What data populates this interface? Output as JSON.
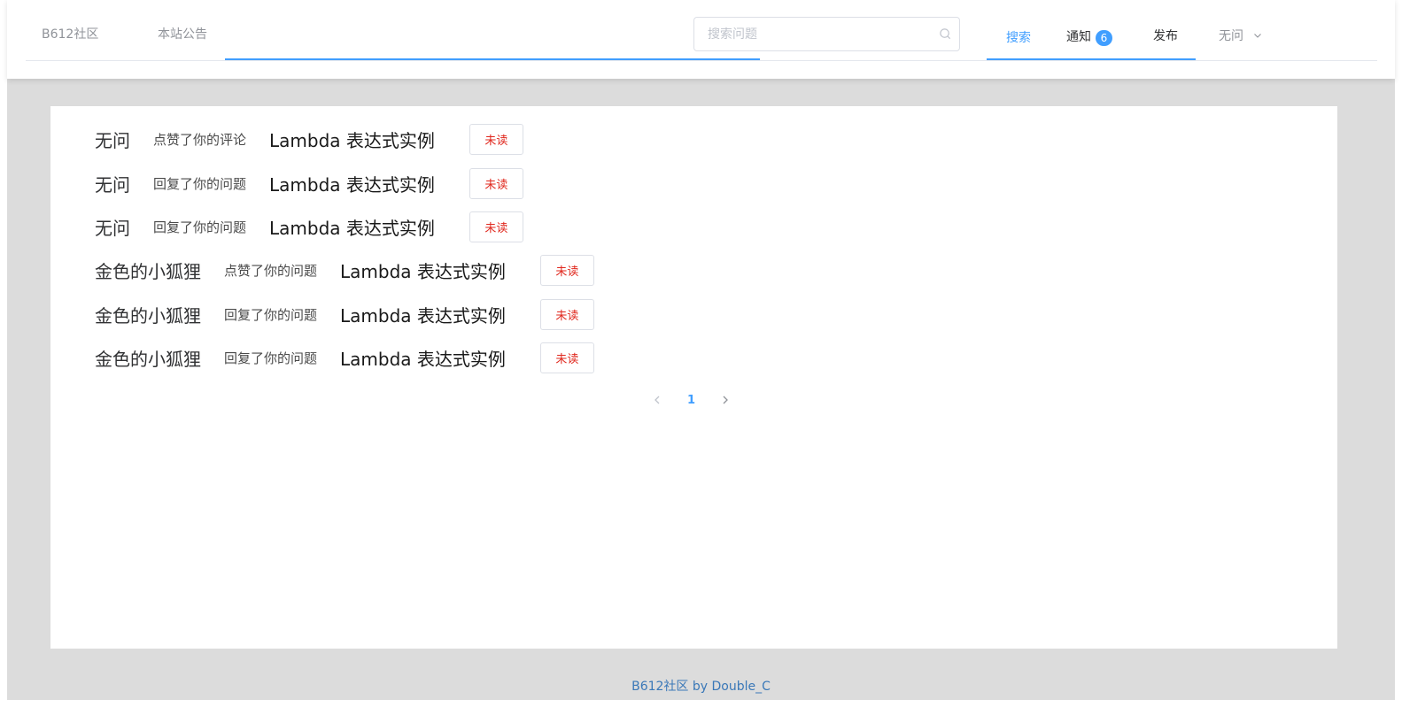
{
  "header": {
    "brand": "B612社区",
    "notice": "本站公告",
    "search": {
      "placeholder": "搜索问题",
      "value": ""
    },
    "menu": {
      "search": "搜索",
      "notify": "通知",
      "notify_count": "6",
      "publish": "发布",
      "user": "无问"
    }
  },
  "notifications": [
    {
      "user": "无问",
      "action": "点赞了你的评论",
      "question": "Lambda 表达式实例",
      "status": "未读"
    },
    {
      "user": "无问",
      "action": "回复了你的问题",
      "question": "Lambda 表达式实例",
      "status": "未读"
    },
    {
      "user": "无问",
      "action": "回复了你的问题",
      "question": "Lambda 表达式实例",
      "status": "未读"
    },
    {
      "user": "金色的小狐狸",
      "action": "点赞了你的问题",
      "question": "Lambda 表达式实例",
      "status": "未读"
    },
    {
      "user": "金色的小狐狸",
      "action": "回复了你的问题",
      "question": "Lambda 表达式实例",
      "status": "未读"
    },
    {
      "user": "金色的小狐狸",
      "action": "回复了你的问题",
      "question": "Lambda 表达式实例",
      "status": "未读"
    }
  ],
  "pagination": {
    "current": "1"
  },
  "footer": {
    "text": "B612社区 by Double_C"
  },
  "colors": {
    "accent": "#409eff",
    "unread": "#e0281e",
    "page_bg": "#dcdcdc"
  },
  "icons": {
    "search": "search-icon",
    "prev": "chevron-left-icon",
    "next": "chevron-right-icon",
    "dropdown": "chevron-down-icon"
  }
}
